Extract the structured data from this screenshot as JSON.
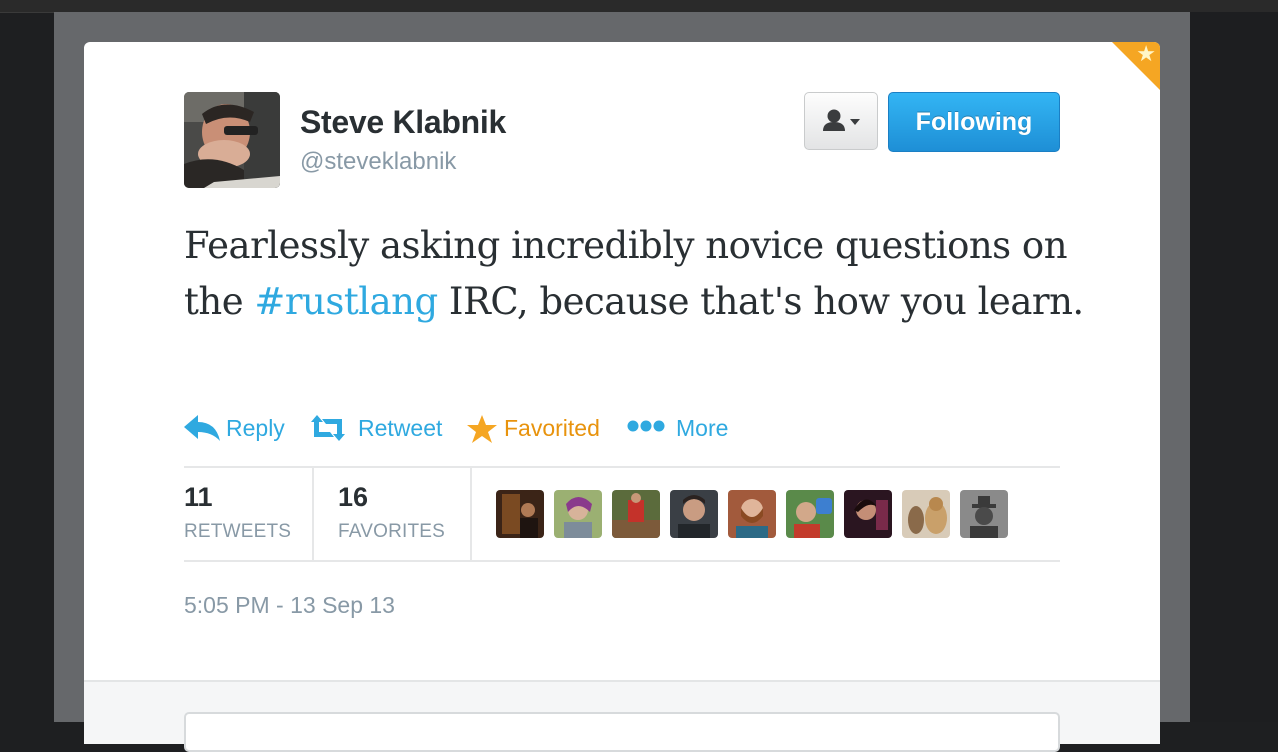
{
  "tweet": {
    "author_name": "Steve Klabnik",
    "author_handle": "@steveklabnik",
    "text_before": "Fearlessly asking incredibly novice questions on the ",
    "hashtag": "#rustlang",
    "text_after": " IRC, because that's how you learn.",
    "timestamp": "5:05 PM - 13 Sep 13",
    "favorited": true
  },
  "buttons": {
    "user_actions_icon": "person-icon",
    "follow_label": "Following"
  },
  "actions": {
    "reply": "Reply",
    "retweet": "Retweet",
    "favorite": "Favorited",
    "more": "More"
  },
  "stats": {
    "retweets_count": "11",
    "retweets_label": "RETWEETS",
    "favorites_count": "16",
    "favorites_label": "FAVORITES"
  },
  "colors": {
    "link_blue": "#2fa9e0",
    "favorite_orange": "#e8930d",
    "button_blue": "#1e8fd6"
  }
}
